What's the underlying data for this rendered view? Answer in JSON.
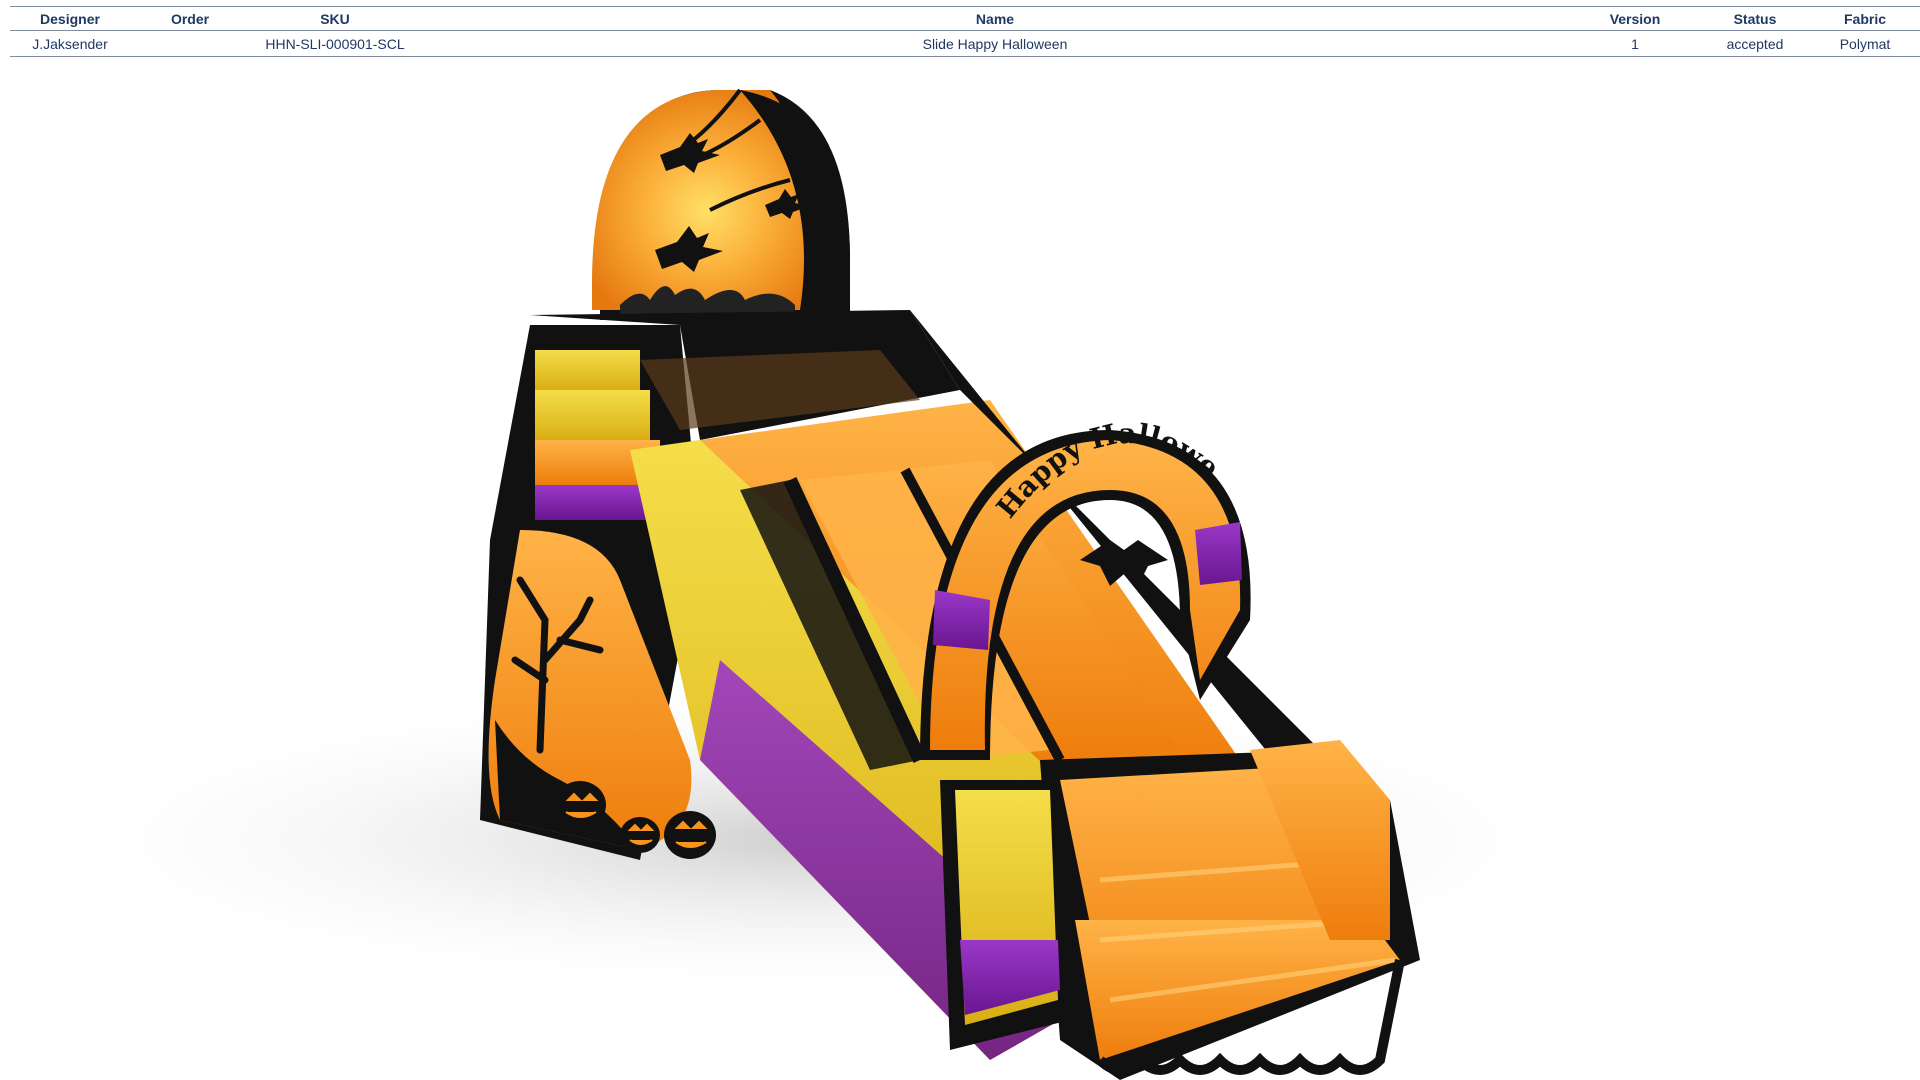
{
  "table": {
    "headers": {
      "designer": "Designer",
      "order": "Order",
      "sku": "SKU",
      "name": "Name",
      "version": "Version",
      "status": "Status",
      "fabric": "Fabric"
    },
    "row": {
      "designer": "J.Jaksender",
      "order": "",
      "sku": "HHN-SLI-000901-SCL",
      "name": "Slide Happy Halloween",
      "version": "1",
      "status": "accepted",
      "fabric": "Polymat"
    }
  },
  "render": {
    "arch_text": "Happy Halloween",
    "colors": {
      "orange": "#f7941d",
      "yellow": "#e8c31a",
      "purple": "#7a1fa2",
      "black": "#111111",
      "header_text": "#1f3864"
    }
  }
}
